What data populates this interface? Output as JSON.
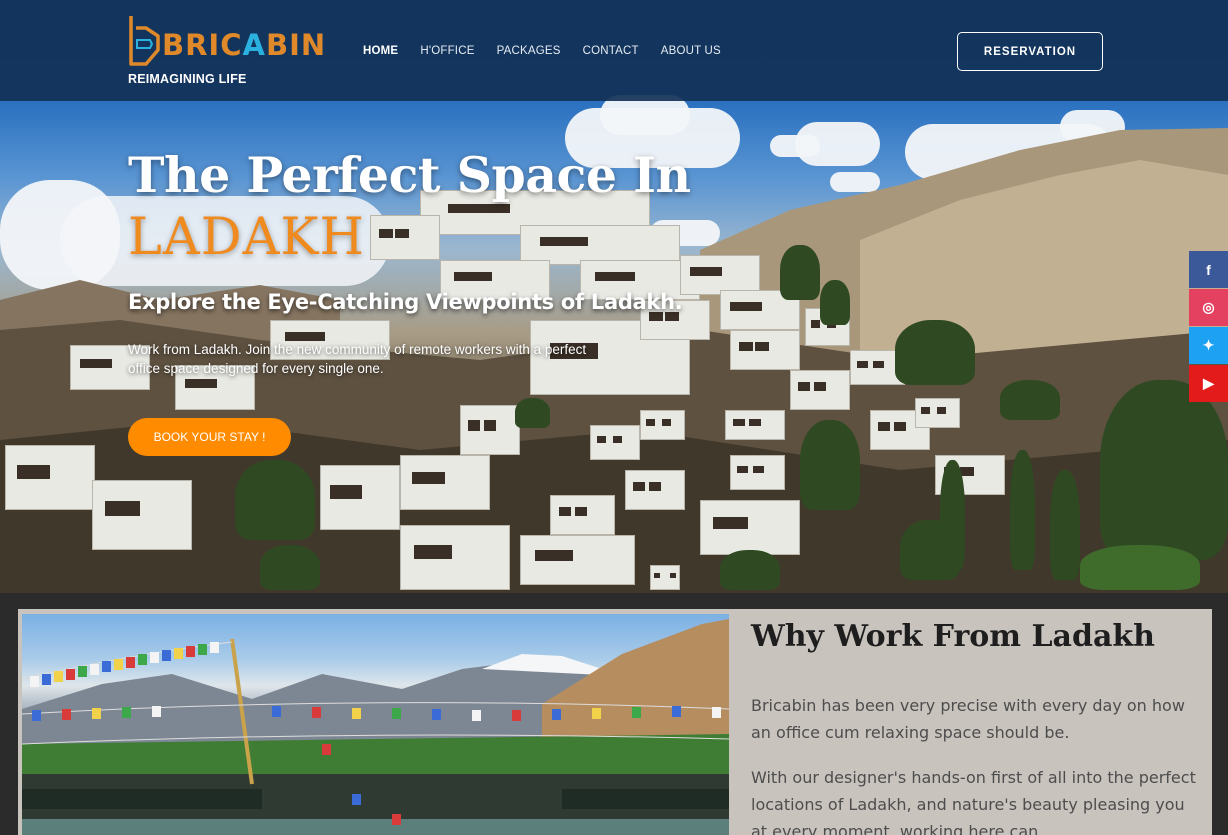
{
  "brand": {
    "logo_part1": "BRIC",
    "logo_part2": "A",
    "logo_part3": "BIN",
    "tagline": "REIMAGINING LIFE",
    "colors": {
      "orange": "#e0892a",
      "blue": "#2bb1e0"
    }
  },
  "nav": {
    "items": [
      {
        "label": "HOME",
        "active": true
      },
      {
        "label": "H'OFFICE",
        "active": false
      },
      {
        "label": "PACKAGES",
        "active": false
      },
      {
        "label": "CONTACT",
        "active": false
      },
      {
        "label": "ABOUT US",
        "active": false
      }
    ],
    "reservation_label": "RESERVATION"
  },
  "hero": {
    "title": "The Perfect Space In",
    "place": "LADAKH",
    "subtitle": "Explore the Eye-Catching Viewpoints  of Ladakh.",
    "description": "Work from Ladakh. Join the new community of remote workers with a perfect office space designed for every single one.",
    "cta_label": "BOOK YOUR STAY !"
  },
  "social": [
    {
      "name": "facebook-icon",
      "glyph": "f",
      "color": "#3b5998"
    },
    {
      "name": "instagram-icon",
      "glyph": "◎",
      "color": "#e4405f"
    },
    {
      "name": "twitter-icon",
      "glyph": "✦",
      "color": "#1da1f2"
    },
    {
      "name": "youtube-icon",
      "glyph": "▶",
      "color": "#e31b1b"
    }
  ],
  "why": {
    "title": "Why Work From Ladakh",
    "paragraph1": "Bricabin has been very precise with every day on how an office cum relaxing space should be.",
    "paragraph2": "With our designer's hands-on first of all into the perfect locations of Ladakh, and nature's beauty pleasing you at every moment, working here can"
  },
  "accent": "#ff8c00"
}
